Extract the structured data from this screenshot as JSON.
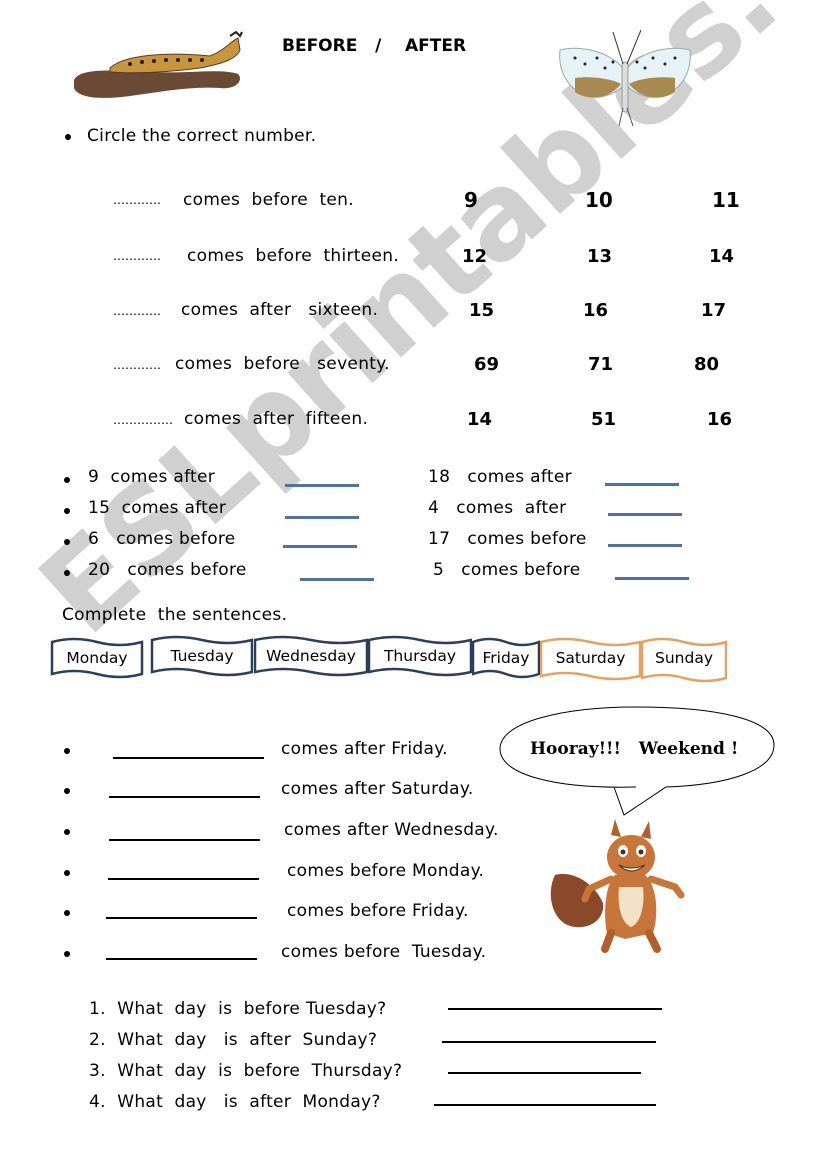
{
  "header": {
    "title": "BEFORE   /    AFTER"
  },
  "images": {
    "left": "caterpillar",
    "right": "moth",
    "bottom": "squirrel"
  },
  "section1": {
    "instruction": "Circle the correct number.",
    "rows": [
      {
        "blank": "…………",
        "text": "comes  before  ten.",
        "options": [
          "9",
          "10",
          "11"
        ]
      },
      {
        "blank": "…………",
        "text": "comes  before  thirteen.",
        "options": [
          "12",
          "13",
          "14"
        ]
      },
      {
        "blank": "…………",
        "text": "comes  after   sixteen.",
        "options": [
          "15",
          "16",
          "17"
        ]
      },
      {
        "blank": "…………",
        "text": "comes  before   seventy.",
        "options": [
          "69",
          "71",
          "80"
        ]
      },
      {
        "blank": "……………",
        "text": "comes  after  fifteen.",
        "options": [
          "14",
          "51",
          "16"
        ]
      }
    ]
  },
  "section2": {
    "left": [
      "9  comes after",
      "15  comes after",
      "6   comes before",
      "20   comes before"
    ],
    "right": [
      "18   comes after",
      "4   comes  after",
      "17   comes before",
      "5   comes before"
    ]
  },
  "section3": {
    "instruction": "Complete  the sentences.",
    "days": [
      {
        "label": "Monday",
        "weekend": false
      },
      {
        "label": "Tuesday",
        "weekend": false
      },
      {
        "label": "Wednesday",
        "weekend": false
      },
      {
        "label": "Thursday",
        "weekend": false
      },
      {
        "label": "Friday",
        "weekend": false
      },
      {
        "label": "Saturday",
        "weekend": true
      },
      {
        "label": "Sunday",
        "weekend": true
      }
    ],
    "weekday_color": "#2b3f5c",
    "weekend_color": "#e8a060",
    "sentences": [
      "comes after Friday.",
      "comes after Saturday.",
      "comes after Wednesday.",
      "comes before Monday.",
      "comes before Friday.",
      "comes before  Tuesday."
    ],
    "bubble": "Hooray!!!   Weekend !"
  },
  "section4": {
    "questions": [
      "1.  What  day  is  before Tuesday?",
      "2.  What  day   is  after  Sunday?",
      "3.  What  day  is  before  Thursday?",
      "4.  What  day   is  after  Monday?"
    ]
  },
  "watermark": "ESLprintables.com"
}
